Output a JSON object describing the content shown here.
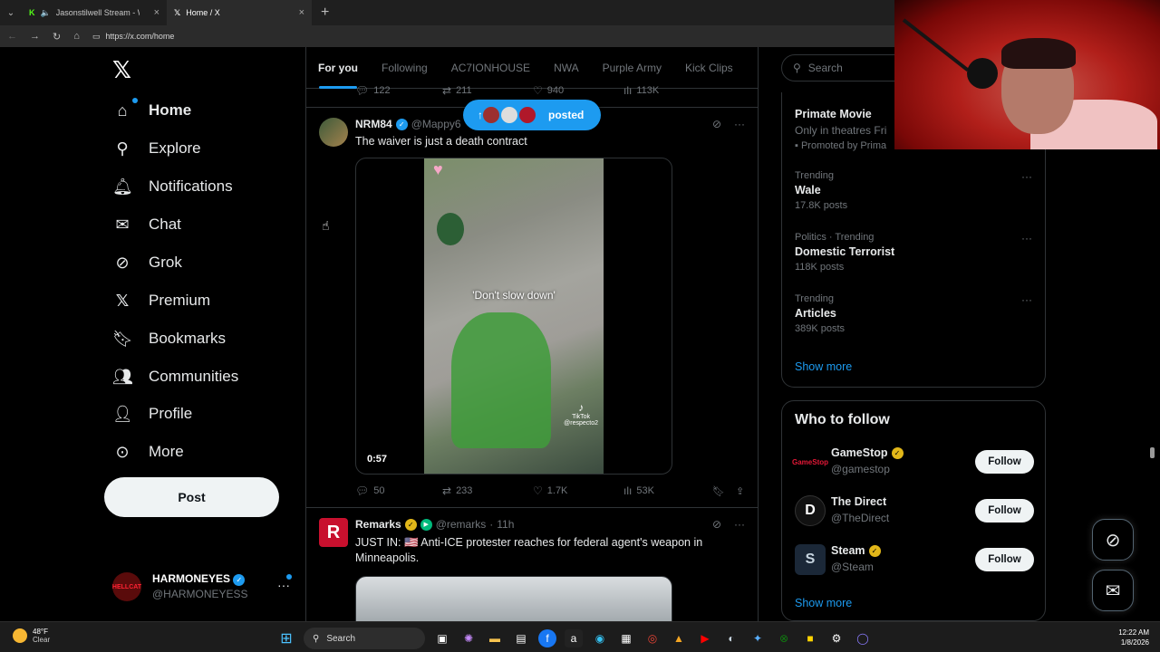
{
  "browser": {
    "tabs": [
      {
        "title": "Jasonstilwell Stream - Watch",
        "icon": "kick-icon"
      },
      {
        "title": "Home / X",
        "icon": "x-icon"
      }
    ],
    "url": "https://x.com/home"
  },
  "nav": {
    "items": [
      {
        "label": "Home",
        "icon": "home-icon"
      },
      {
        "label": "Explore",
        "icon": "search-icon"
      },
      {
        "label": "Notifications",
        "icon": "bell-icon"
      },
      {
        "label": "Chat",
        "icon": "mail-icon"
      },
      {
        "label": "Grok",
        "icon": "grok-icon"
      },
      {
        "label": "Premium",
        "icon": "x-icon"
      },
      {
        "label": "Bookmarks",
        "icon": "bookmark-icon"
      },
      {
        "label": "Communities",
        "icon": "communities-icon"
      },
      {
        "label": "Profile",
        "icon": "person-icon"
      },
      {
        "label": "More",
        "icon": "more-circle-icon"
      }
    ],
    "post_label": "Post",
    "account": {
      "name": "HARMONEYES",
      "handle": "@HARMONEYESS",
      "avatar_text": "HELLCAT"
    }
  },
  "feed": {
    "tabs": [
      "For you",
      "Following",
      "AC7IONHOUSE",
      "NWA",
      "Purple Army",
      "Kick Clips"
    ],
    "active_tab": "For you",
    "posted_pill": "posted",
    "prev_stats": {
      "replies": "122",
      "reposts": "211",
      "likes": "940",
      "views": "113K"
    },
    "tweet1": {
      "name": "NRM84",
      "handle": "@Mappy6",
      "text": "The waiver is just a death contract",
      "video_caption": "'Don't slow down'",
      "tiktok": "TikTok",
      "tiktok_handle": "@respecto2",
      "duration": "0:57",
      "stats": {
        "replies": "50",
        "reposts": "233",
        "likes": "1.7K",
        "views": "53K"
      }
    },
    "tweet2": {
      "name": "Remarks",
      "handle": "@remarks",
      "time": "11h",
      "avatar_text": "R",
      "text": "JUST IN: 🇺🇸 Anti-ICE protester reaches for federal agent's weapon in Minneapolis."
    }
  },
  "sidebar": {
    "search_placeholder": "Search",
    "promoted": {
      "title": "Primate Movie",
      "subtitle": "Only in theatres Fri",
      "tag": "Promoted by Prima"
    },
    "trends": [
      {
        "category": "Trending",
        "title": "Wale",
        "count": "17.8K posts"
      },
      {
        "category": "Politics · Trending",
        "title": "Domestic Terrorist",
        "count": "118K posts"
      },
      {
        "category": "Trending",
        "title": "Articles",
        "count": "389K posts"
      }
    ],
    "show_more": "Show more",
    "who_to_follow": {
      "title": "Who to follow",
      "accounts": [
        {
          "name": "GameStop",
          "handle": "@gamestop",
          "verified": "gold",
          "avatar_text": "GameStop"
        },
        {
          "name": "The Direct",
          "handle": "@TheDirect",
          "verified": "none",
          "avatar_text": "D"
        },
        {
          "name": "Steam",
          "handle": "@Steam",
          "verified": "gold",
          "avatar_text": "S"
        }
      ],
      "follow_label": "Follow",
      "show_more": "Show more"
    }
  },
  "taskbar": {
    "weather_temp": "48°F",
    "weather_desc": "Clear",
    "search_label": "Search",
    "time": "12:22 AM",
    "date": "1/8/2026"
  },
  "colors": {
    "accent": "#1d9bf0",
    "background": "#000000",
    "border": "#2f3336",
    "muted": "#71767b"
  }
}
